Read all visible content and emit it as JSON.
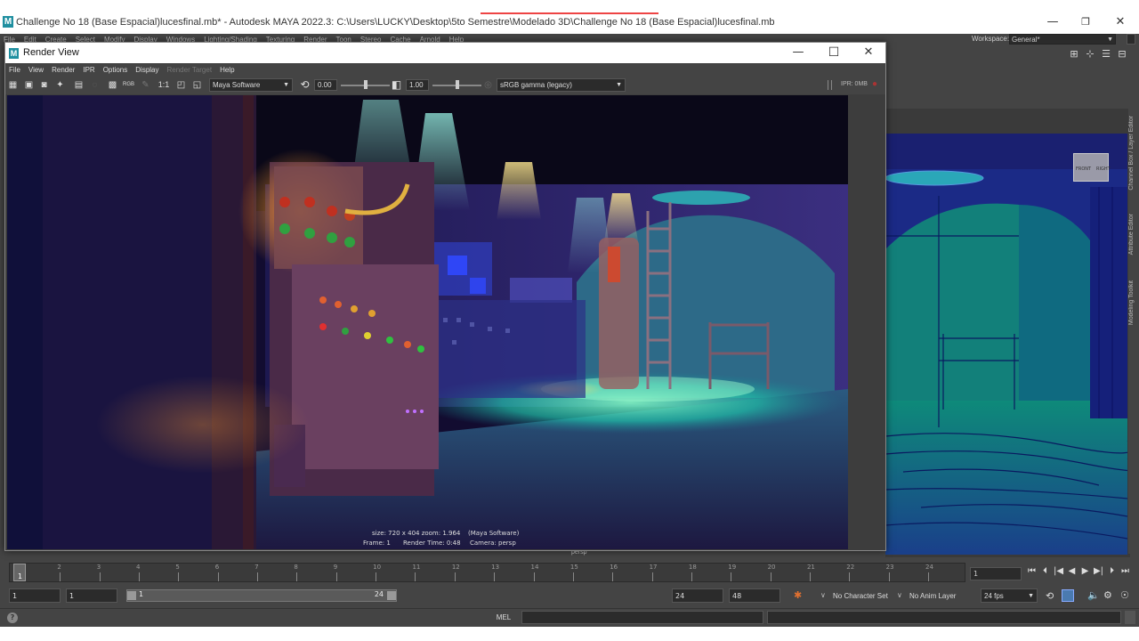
{
  "app": {
    "title": "Challenge No 18 (Base Espacial)lucesfinal.mb* - Autodesk MAYA 2022.3: C:\\Users\\LUCKY\\Desktop\\5to Semestre\\Modelado 3D\\Challenge No 18 (Base Espacial)lucesfinal.mb",
    "logo_letter": "M",
    "minimize_icon": "—",
    "restore_icon": "❐",
    "close_icon": "✕"
  },
  "main_menu": [
    "File",
    "Edit",
    "Create",
    "Select",
    "Modify",
    "Display",
    "Windows",
    "Lighting/Shading",
    "Texturing",
    "Render",
    "Toon",
    "Stereo",
    "Cache",
    "Arnold",
    "Help"
  ],
  "workspace": {
    "label": "Workspace:",
    "value": "General*"
  },
  "right_tools": [
    "⊞",
    "⊹",
    "☰",
    "⊟"
  ],
  "side_tabs": [
    "Channel Box / Layer Editor",
    "Attribute Editor",
    "Modeling Toolkit"
  ],
  "viewport": {
    "camera_label": "persp",
    "viewcube_front": "FRONT",
    "viewcube_right": "RIGHT"
  },
  "render_view": {
    "title": "Render View",
    "menu": [
      "File",
      "View",
      "Render",
      "IPR",
      "Options",
      "Display",
      "Render Target",
      "Help"
    ],
    "menu_disabled": "Render Target",
    "toolbar": {
      "ratio_label": "1:1",
      "renderer": "Maya Software",
      "exposure": "0.00",
      "gamma": "1.00",
      "color_space": "sRGB gamma (legacy)",
      "rgb_label": "RGB",
      "ipr_label": "IPR: 0MB",
      "exposure_slider_value": 0.5,
      "gamma_slider_value": 0.5
    },
    "info": {
      "line1_size": "size: 720 x 404 zoom: 1.964",
      "line1_renderer": "(Maya Software)",
      "line2_frame": "Frame: 1",
      "line2_time": "Render Time: 0:48",
      "line2_camera": "Camera: persp"
    },
    "colors": {
      "accent": "#1f8fa0",
      "panel": "#3d3d3d"
    }
  },
  "timeline": {
    "ticks": [
      "1",
      "2",
      "3",
      "4",
      "5",
      "6",
      "7",
      "8",
      "9",
      "10",
      "11",
      "12",
      "13",
      "14",
      "15",
      "16",
      "17",
      "18",
      "19",
      "20",
      "21",
      "22",
      "23",
      "24"
    ],
    "current_frame": "1",
    "current_frame_field": "1",
    "playback_icons": [
      "⏮",
      "⏴",
      "|◀",
      "◀",
      "▶",
      "▶|",
      "⏵",
      "⏭"
    ]
  },
  "range": {
    "start": "1",
    "start_inner": "1",
    "slider_start": "1",
    "slider_end": "24",
    "end_inner": "24",
    "end": "48",
    "character_set": "No Character Set",
    "anim_layer": "No Anim Layer",
    "fps": "24 fps"
  },
  "command_line": {
    "language": "MEL"
  },
  "help_icon": "?"
}
